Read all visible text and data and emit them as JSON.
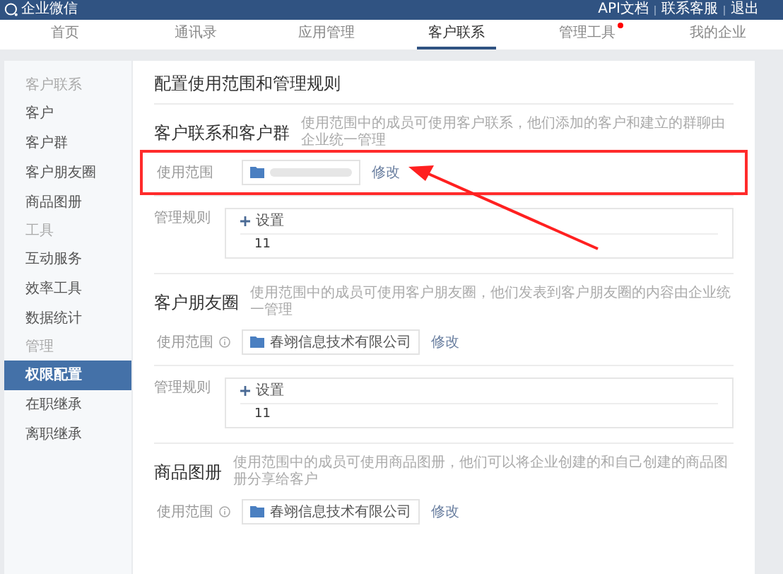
{
  "header": {
    "logo_text": "企业微信",
    "links": [
      "API文档",
      "联系客服",
      "退出"
    ]
  },
  "tabs": [
    {
      "label": "首页",
      "selected": false,
      "dot": false
    },
    {
      "label": "通讯录",
      "selected": false,
      "dot": false
    },
    {
      "label": "应用管理",
      "selected": false,
      "dot": false
    },
    {
      "label": "客户联系",
      "selected": true,
      "dot": false
    },
    {
      "label": "管理工具",
      "selected": false,
      "dot": true
    },
    {
      "label": "我的企业",
      "selected": false,
      "dot": false
    }
  ],
  "sidebar": {
    "items": [
      {
        "kind": "group",
        "label": "客户联系"
      },
      {
        "kind": "item",
        "label": "客户",
        "selected": false
      },
      {
        "kind": "item",
        "label": "客户群",
        "selected": false
      },
      {
        "kind": "item",
        "label": "客户朋友圈",
        "selected": false
      },
      {
        "kind": "item",
        "label": "商品图册",
        "selected": false
      },
      {
        "kind": "group",
        "label": "工具"
      },
      {
        "kind": "item",
        "label": "互动服务",
        "selected": false
      },
      {
        "kind": "item",
        "label": "效率工具",
        "selected": false
      },
      {
        "kind": "item",
        "label": "数据统计",
        "selected": false
      },
      {
        "kind": "group",
        "label": "管理"
      },
      {
        "kind": "item",
        "label": "权限配置",
        "selected": true
      },
      {
        "kind": "item",
        "label": "在职继承",
        "selected": false
      },
      {
        "kind": "item",
        "label": "离职继承",
        "selected": false
      }
    ]
  },
  "page_title": "配置使用范围和管理规则",
  "sections": [
    {
      "title": "客户联系和客户群",
      "description": "使用范围中的成员可使用客户联系，他们添加的客户和建立的群聊由企业统一管理",
      "scope": {
        "label": "使用范围",
        "info": false,
        "blurred": true,
        "edit": "修改",
        "highlighted": true
      },
      "rules": {
        "label": "管理规则",
        "add": "设置",
        "items": [
          "11"
        ]
      }
    },
    {
      "title": "客户朋友圈",
      "description": "使用范围中的成员可使用客户朋友圈，他们发表到客户朋友圈的内容由企业统一管理",
      "scope": {
        "label": "使用范围",
        "info": true,
        "blurred": false,
        "org": "春翊信息技术有限公司",
        "edit": "修改",
        "highlighted": false
      },
      "rules": {
        "label": "管理规则",
        "add": "设置",
        "items": [
          "11"
        ]
      }
    },
    {
      "title": "商品图册",
      "description": "使用范围中的成员可使用商品图册，他们可以将企业创建的和自己创建的商品图册分享给客户",
      "scope": {
        "label": "使用范围",
        "info": true,
        "blurred": false,
        "org": "春翊信息技术有限公司",
        "edit": "修改",
        "highlighted": false
      }
    }
  ]
}
